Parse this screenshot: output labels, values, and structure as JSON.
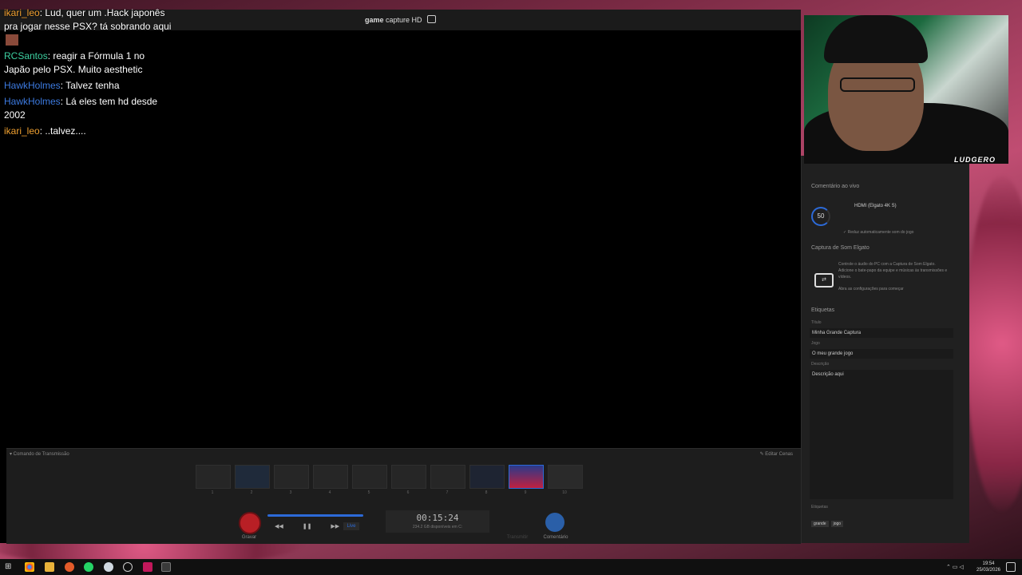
{
  "app": {
    "title_bold": "game",
    "title_rest": "capture HD"
  },
  "chat": [
    {
      "user": "ikari_leo",
      "text": ": Lud, quer um .Hack japonês pra jogar nesse PSX? tá sobrando aqui",
      "color": "#f0a030",
      "emote": true
    },
    {
      "user": "RCSantos",
      "text": ": reagir a Fórmula 1 no Japão pelo PSX. Muito aesthetic",
      "color": "#3dcfa0"
    },
    {
      "user": "HawkHolmes",
      "text": ": Talvez tenha",
      "color": "#3c7ae0"
    },
    {
      "user": "HawkHolmes",
      "text": ": Lá eles tem hd desde 2002",
      "color": "#3c7ae0"
    },
    {
      "user": "ikari_leo",
      "text": ": ..talvez....",
      "color": "#f0a030"
    }
  ],
  "command": {
    "header": "▾ Comando de Transmissão",
    "edit": "✎ Editar Cenas",
    "scenes": [
      "1",
      "2",
      "3",
      "4",
      "5",
      "6",
      "7",
      "8",
      "9",
      "10"
    ],
    "record_label": "Gravar",
    "live_label": "Live",
    "time": "00:15:24",
    "disk": "234.2 GB disponíveis em C:",
    "fade_label": "Transmitir",
    "comment_label": "Comentário"
  },
  "panel": {
    "live_comment_title": "Comentário ao vivo",
    "dial_value": "50",
    "source": "HDMI (Elgato 4K S)",
    "reduce_option": "✓ Reduz automaticamente som do jogo",
    "sound_capture_title": "Captura de Som Elgato",
    "sound_capture_desc": "Controle o áudio do PC com a Captura de Som Elgato. Adicione o bate-papo da equipe e músicas às transmissões e vídeos.",
    "sound_capture_link": "Abra as configurações para começar",
    "tags_title": "Etiquetas",
    "title_label": "Título",
    "title_value": "Minha Grande Captura",
    "game_label": "Jogo",
    "game_value": "O meu grande jogo",
    "desc_label": "Descrição",
    "desc_value": "Descrição aqui",
    "tags_label": "Etiquetas",
    "tags": [
      "grande",
      "jogo"
    ]
  },
  "webcam": {
    "watermark": "LUDGERO"
  },
  "taskbar": {
    "time": "19:54",
    "date": "25/03/2026"
  }
}
